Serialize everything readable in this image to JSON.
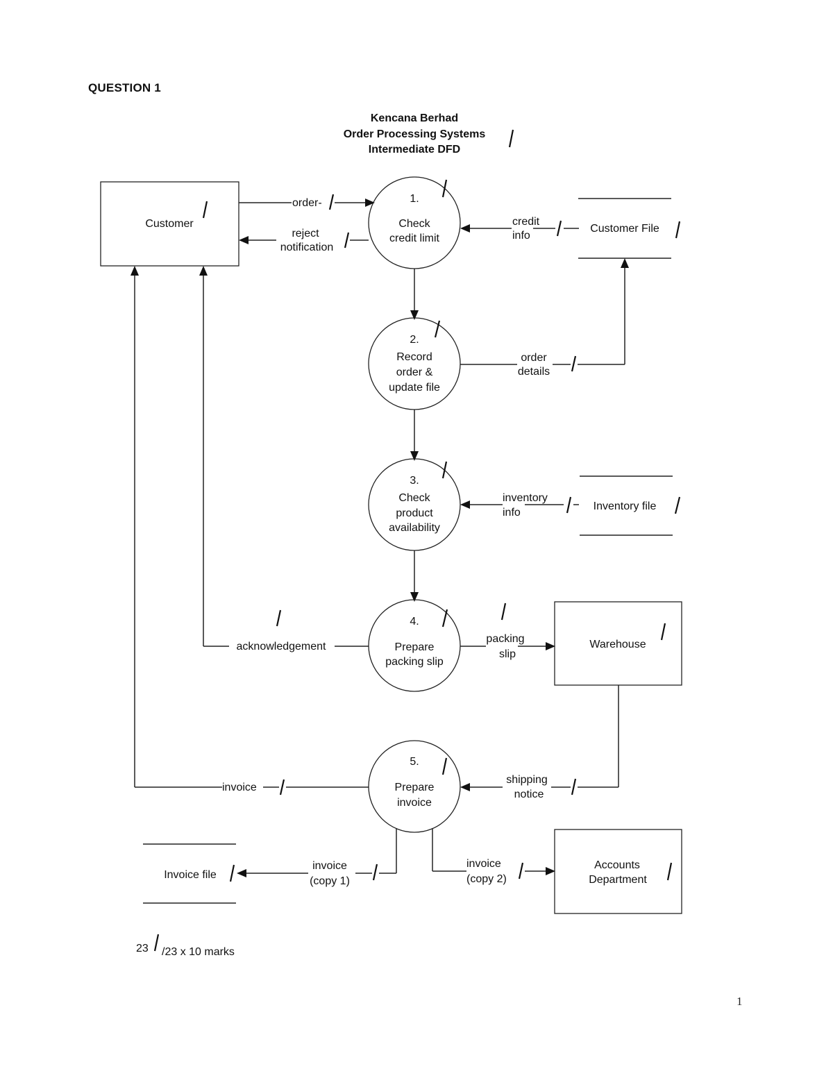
{
  "page": {
    "heading": "QUESTION 1",
    "page_number": "1"
  },
  "diagram": {
    "title_lines": [
      "Kencana Berhad",
      "Order Processing Systems",
      "Intermediate DFD"
    ],
    "external_entities": {
      "customer": "Customer",
      "warehouse": "Warehouse",
      "accounts": [
        "Accounts",
        "Department"
      ]
    },
    "processes": [
      {
        "number": "1.",
        "lines": [
          "Check",
          "credit limit"
        ]
      },
      {
        "number": "2.",
        "lines": [
          "Record",
          "order &",
          "update file"
        ]
      },
      {
        "number": "3.",
        "lines": [
          "Check",
          "product",
          "availability"
        ]
      },
      {
        "number": "4.",
        "lines": [
          "Prepare",
          "packing slip"
        ]
      },
      {
        "number": "5.",
        "lines": [
          "Prepare",
          "invoice"
        ]
      }
    ],
    "data_stores": {
      "customer_file": "Customer File",
      "inventory_file": "Inventory file",
      "invoice_file": "Invoice file"
    },
    "flows": {
      "order": "order-",
      "reject": [
        "reject",
        "notification"
      ],
      "credit_info": [
        "credit",
        "info"
      ],
      "order_details": [
        "order",
        "details"
      ],
      "inventory_info": [
        "inventory",
        "info"
      ],
      "acknowledgement": "acknowledgement",
      "packing_slip": [
        "packing",
        "slip"
      ],
      "invoice": "invoice",
      "shipping_notice": [
        "shipping",
        "notice"
      ],
      "invoice_copy1": [
        "invoice",
        "(copy 1)"
      ],
      "invoice_copy2": [
        "invoice",
        "(copy 2)"
      ]
    },
    "score": {
      "numerator": "23",
      "rest": "/23 x 10 marks"
    }
  }
}
